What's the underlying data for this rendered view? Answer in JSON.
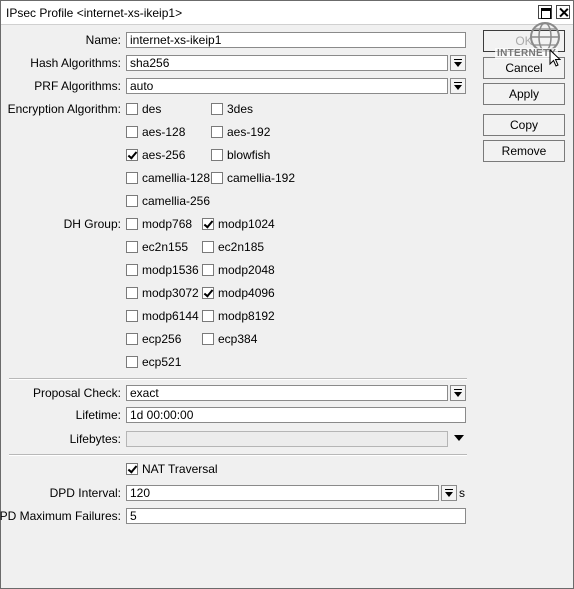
{
  "window": {
    "title": "IPsec Profile <internet-xs-ikeip1>",
    "maximize_icon": "maximize-icon",
    "close_icon": "close-icon"
  },
  "form": {
    "name": {
      "label": "Name:",
      "value": "internet-xs-ikeip1"
    },
    "hash_algorithms": {
      "label": "Hash Algorithms:",
      "value": "sha256"
    },
    "prf_algorithms": {
      "label": "PRF Algorithms:",
      "value": "auto"
    },
    "encryption_algorithm": {
      "label": "Encryption Algorithm:",
      "options": [
        {
          "label": "des",
          "checked": false
        },
        {
          "label": "3des",
          "checked": false
        },
        {
          "label": "aes-128",
          "checked": false
        },
        {
          "label": "aes-192",
          "checked": false
        },
        {
          "label": "aes-256",
          "checked": true
        },
        {
          "label": "blowfish",
          "checked": false
        },
        {
          "label": "camellia-128",
          "checked": false
        },
        {
          "label": "camellia-192",
          "checked": false
        },
        {
          "label": "camellia-256",
          "checked": false
        }
      ]
    },
    "dh_group": {
      "label": "DH Group:",
      "options": [
        {
          "label": "modp768",
          "checked": false
        },
        {
          "label": "modp1024",
          "checked": true
        },
        {
          "label": "ec2n155",
          "checked": false
        },
        {
          "label": "ec2n185",
          "checked": false
        },
        {
          "label": "modp1536",
          "checked": false
        },
        {
          "label": "modp2048",
          "checked": false
        },
        {
          "label": "modp3072",
          "checked": false
        },
        {
          "label": "modp4096",
          "checked": true
        },
        {
          "label": "modp6144",
          "checked": false
        },
        {
          "label": "modp8192",
          "checked": false
        },
        {
          "label": "ecp256",
          "checked": false
        },
        {
          "label": "ecp384",
          "checked": false
        },
        {
          "label": "ecp521",
          "checked": false
        }
      ]
    },
    "proposal_check": {
      "label": "Proposal Check:",
      "value": "exact"
    },
    "lifetime": {
      "label": "Lifetime:",
      "value": "1d 00:00:00"
    },
    "lifebytes": {
      "label": "Lifebytes:",
      "value": ""
    },
    "nat_traversal": {
      "label": "NAT Traversal",
      "checked": true
    },
    "dpd_interval": {
      "label": "DPD Interval:",
      "value": "120",
      "unit": "s"
    },
    "dpd_maximum_failures": {
      "label": "DPD Maximum Failures:",
      "value": "5"
    }
  },
  "buttons": {
    "ok": "OK",
    "cancel": "Cancel",
    "apply": "Apply",
    "copy": "Copy",
    "remove": "Remove"
  },
  "overlay": {
    "watermark_text": "INTERNETX"
  }
}
